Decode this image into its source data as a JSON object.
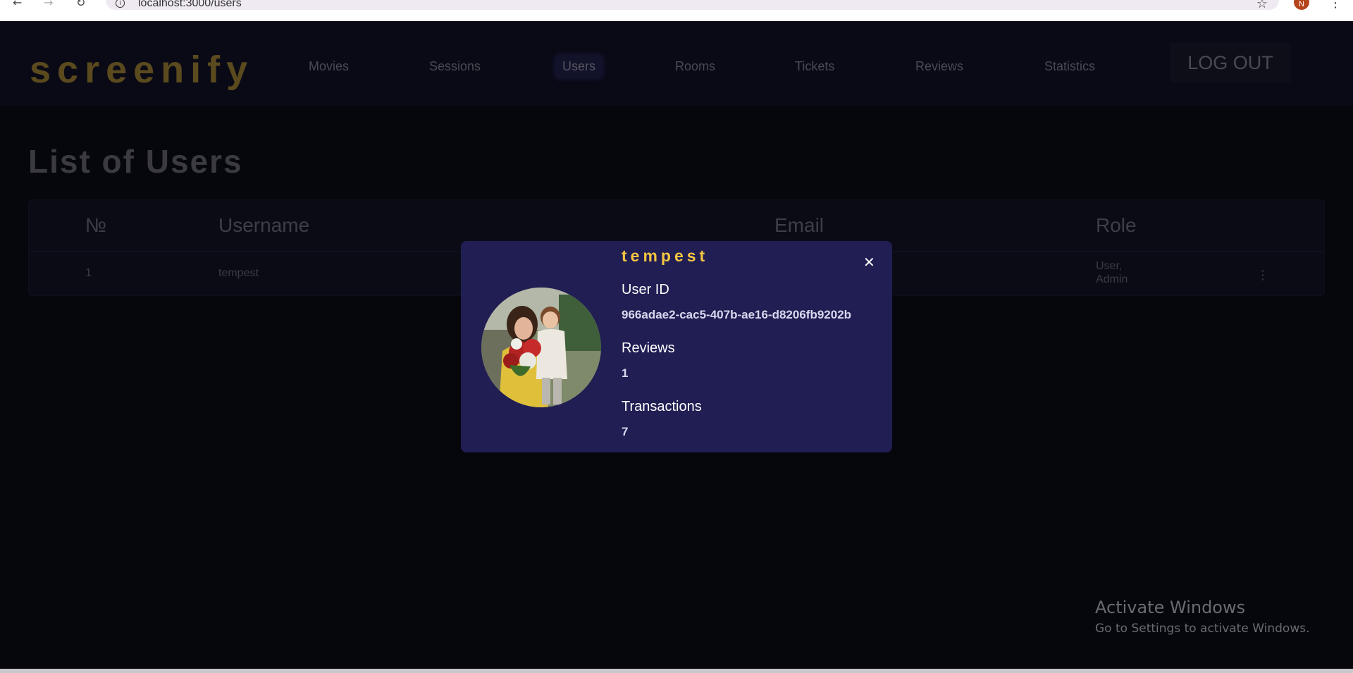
{
  "browser": {
    "url": "localhost:3000/users",
    "profile_initial": "N"
  },
  "header": {
    "logo": "screenify",
    "nav": [
      "Movies",
      "Sessions",
      "Users",
      "Rooms",
      "Tickets",
      "Reviews",
      "Statistics"
    ],
    "active_nav": "Users",
    "logout_label": "LOG OUT"
  },
  "page": {
    "title": "List of Users",
    "columns": [
      "№",
      "Username",
      "Email",
      "Role"
    ],
    "rows": [
      {
        "number": "1",
        "username": "tempest",
        "role_line1": "User,",
        "role_line2": "Admin"
      }
    ]
  },
  "modal": {
    "username": "tempest",
    "user_id_label": "User ID",
    "user_id": "966adae2-cac5-407b-ae16-d8206fb9202b",
    "reviews_label": "Reviews",
    "reviews": "1",
    "transactions_label": "Transactions",
    "transactions": "7"
  },
  "watermark": {
    "title": "Activate Windows",
    "subtitle": "Go to Settings to activate Windows."
  },
  "colors": {
    "modal_bg": "#211e53",
    "username_accent": "#f4c542",
    "logo": "#5a4a1e",
    "page_bg": "#06060d"
  },
  "icons": [
    "back-arrow-icon",
    "forward-arrow-icon",
    "reload-icon",
    "info-icon",
    "star-icon",
    "close-icon",
    "kebab-menu-icon"
  ]
}
